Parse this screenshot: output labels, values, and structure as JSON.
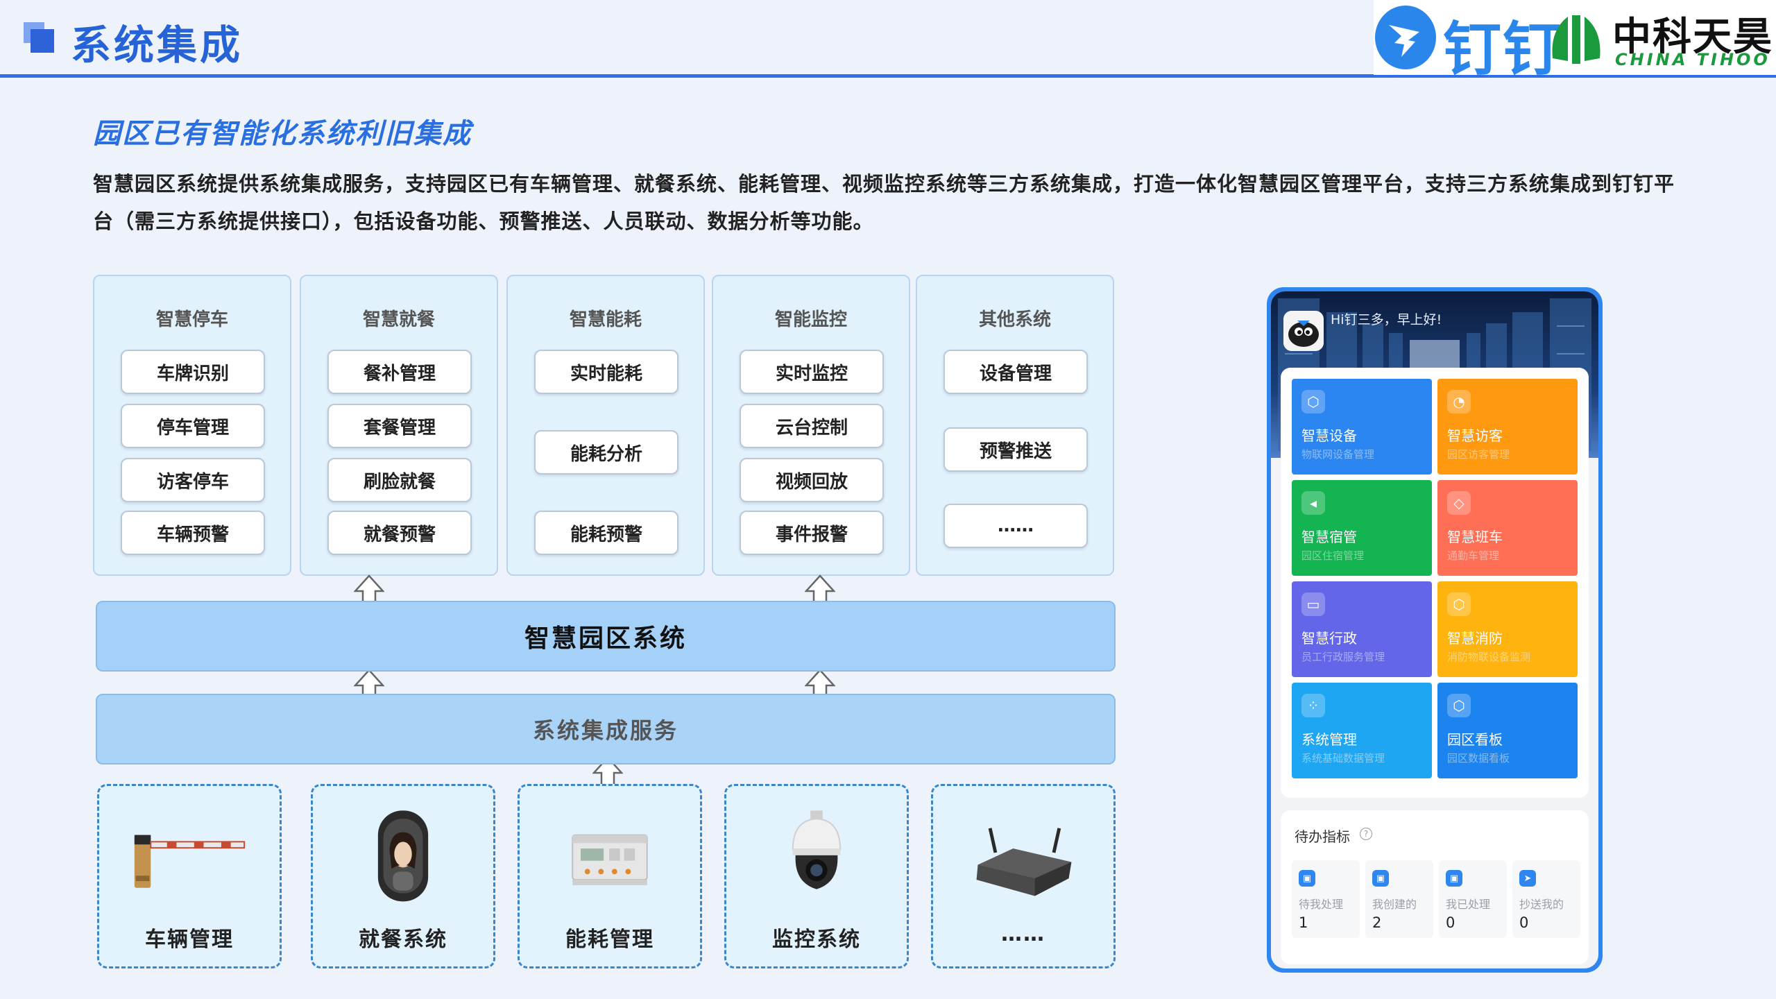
{
  "header": {
    "title": "系统集成",
    "logo_dingtalk": "钉钉",
    "logo_company_cn": "中科天昊",
    "logo_company_en": "CHINA TIHOO"
  },
  "intro": {
    "title": "园区已有智能化系统利旧集成",
    "body": "智慧园区系统提供系统集成服务，支持园区已有车辆管理、就餐系统、能耗管理、视频监控系统等三方系统集成，打造一体化智慧园区管理平台，支持三方系统集成到钉钉平台（需三方系统提供接口），包括设备功能、预警推送、人员联动、数据分析等功能。"
  },
  "categories": [
    {
      "title": "智慧停车",
      "items": [
        "车牌识别",
        "停车管理",
        "访客停车",
        "车辆预警"
      ]
    },
    {
      "title": "智慧就餐",
      "items": [
        "餐补管理",
        "套餐管理",
        "刷脸就餐",
        "就餐预警"
      ]
    },
    {
      "title": "智慧能耗",
      "items": [
        "实时能耗",
        "能耗分析",
        "能耗预警"
      ]
    },
    {
      "title": "智能监控",
      "items": [
        "实时监控",
        "云台控制",
        "视频回放",
        "事件报警"
      ]
    },
    {
      "title": "其他系统",
      "items": [
        "设备管理",
        "预警推送",
        "……"
      ]
    }
  ],
  "bars": {
    "system": "智慧园区系统",
    "service": "系统集成服务"
  },
  "devices": [
    {
      "label": "车辆管理",
      "icon": "barrier-gate-icon"
    },
    {
      "label": "就餐系统",
      "icon": "face-terminal-icon"
    },
    {
      "label": "能耗管理",
      "icon": "power-meter-icon"
    },
    {
      "label": "监控系统",
      "icon": "dome-camera-icon"
    },
    {
      "label": "……",
      "icon": "router-icon"
    }
  ],
  "phone": {
    "greeting": "Hi钉三多，早上好!",
    "tiles": [
      {
        "name": "智慧设备",
        "sub": "物联网设备管理",
        "color": "#2c86f2",
        "icon": "cube-icon"
      },
      {
        "name": "智慧访客",
        "sub": "园区访客管理",
        "color": "#ff9a10",
        "icon": "user-icon"
      },
      {
        "name": "智慧宿管",
        "sub": "园区住宿管理",
        "color": "#13b451",
        "icon": "megaphone-icon"
      },
      {
        "name": "智慧班车",
        "sub": "通勤车管理",
        "color": "#ff6f55",
        "icon": "diamond-icon"
      },
      {
        "name": "智慧行政",
        "sub": "员工行政服务管理",
        "color": "#6366e8",
        "icon": "monitor-icon"
      },
      {
        "name": "智慧消防",
        "sub": "消防物联设备监测",
        "color": "#ffb30e",
        "icon": "cube-icon"
      },
      {
        "name": "系统管理",
        "sub": "系统基础数据管理",
        "color": "#1fa6f2",
        "icon": "apps-icon"
      },
      {
        "name": "园区看板",
        "sub": "园区数据看板",
        "color": "#1c84ee",
        "icon": "cube-icon"
      }
    ],
    "todo": {
      "title": "待办指标",
      "help": "?",
      "items": [
        {
          "label": "待我处理",
          "count": "1"
        },
        {
          "label": "我创建的",
          "count": "2"
        },
        {
          "label": "我已处理",
          "count": "0"
        },
        {
          "label": "抄送我的",
          "count": "0"
        }
      ]
    }
  }
}
